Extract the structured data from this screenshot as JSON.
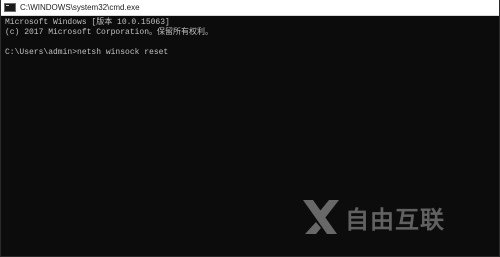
{
  "window": {
    "title": "C:\\WINDOWS\\system32\\cmd.exe",
    "icon": "cmd-console-icon"
  },
  "console": {
    "lines": [
      "Microsoft Windows [版本 10.0.15063]",
      "(c) 2017 Microsoft Corporation。保留所有权利。",
      "",
      "C:\\Users\\admin>netsh winsock reset"
    ]
  },
  "watermark": {
    "text": "自由互联",
    "logo": "x-logo"
  },
  "colors": {
    "console_background": "#0c0c0c",
    "console_text": "#c0c0c0",
    "titlebar_background": "#ffffff"
  }
}
